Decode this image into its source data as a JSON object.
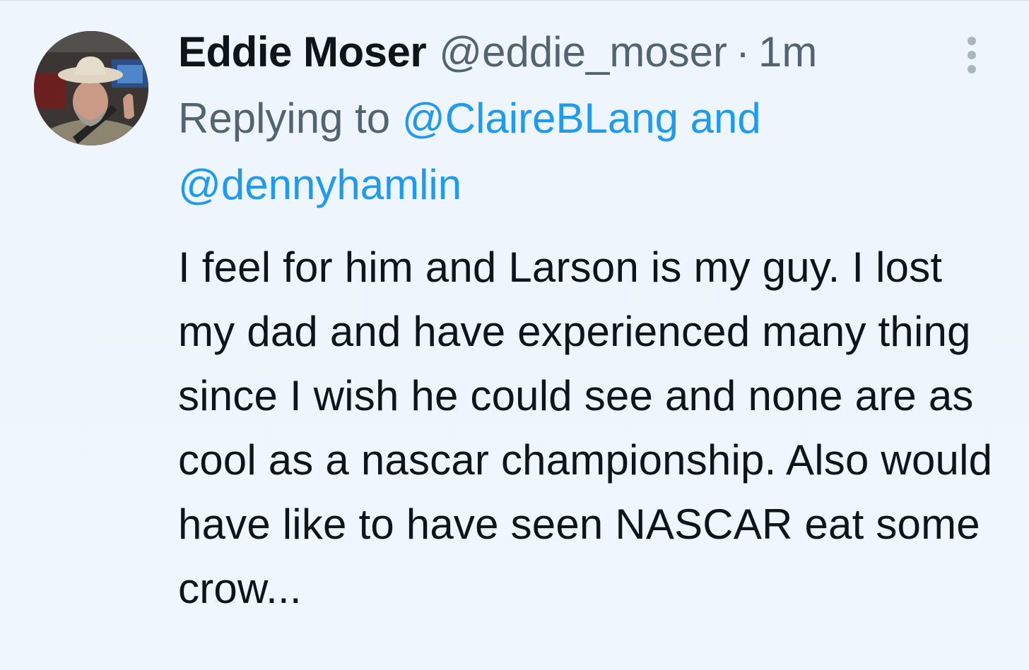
{
  "tweet": {
    "author": {
      "display_name": "Eddie Moser",
      "handle": "@eddie_moser",
      "avatar_icon": "profile-photo-cowboy-hat"
    },
    "separator": "·",
    "timestamp": "1m",
    "reply": {
      "prefix": "Replying to ",
      "mentions": [
        "@ClaireBLang",
        "@dennyhamlin"
      ],
      "conjunction": "and"
    },
    "text": "I feel for him and Larson is my guy. I lost my dad and have experienced many thing since I wish he could see and none are as cool as a nascar championship. Also would have like to have seen NASCAR eat some crow...",
    "more_icon": "more-vertical-icon"
  },
  "colors": {
    "background": "#eef5fc",
    "text_primary": "#0f1419",
    "text_secondary": "#536471",
    "accent": "#1d9bf0"
  }
}
